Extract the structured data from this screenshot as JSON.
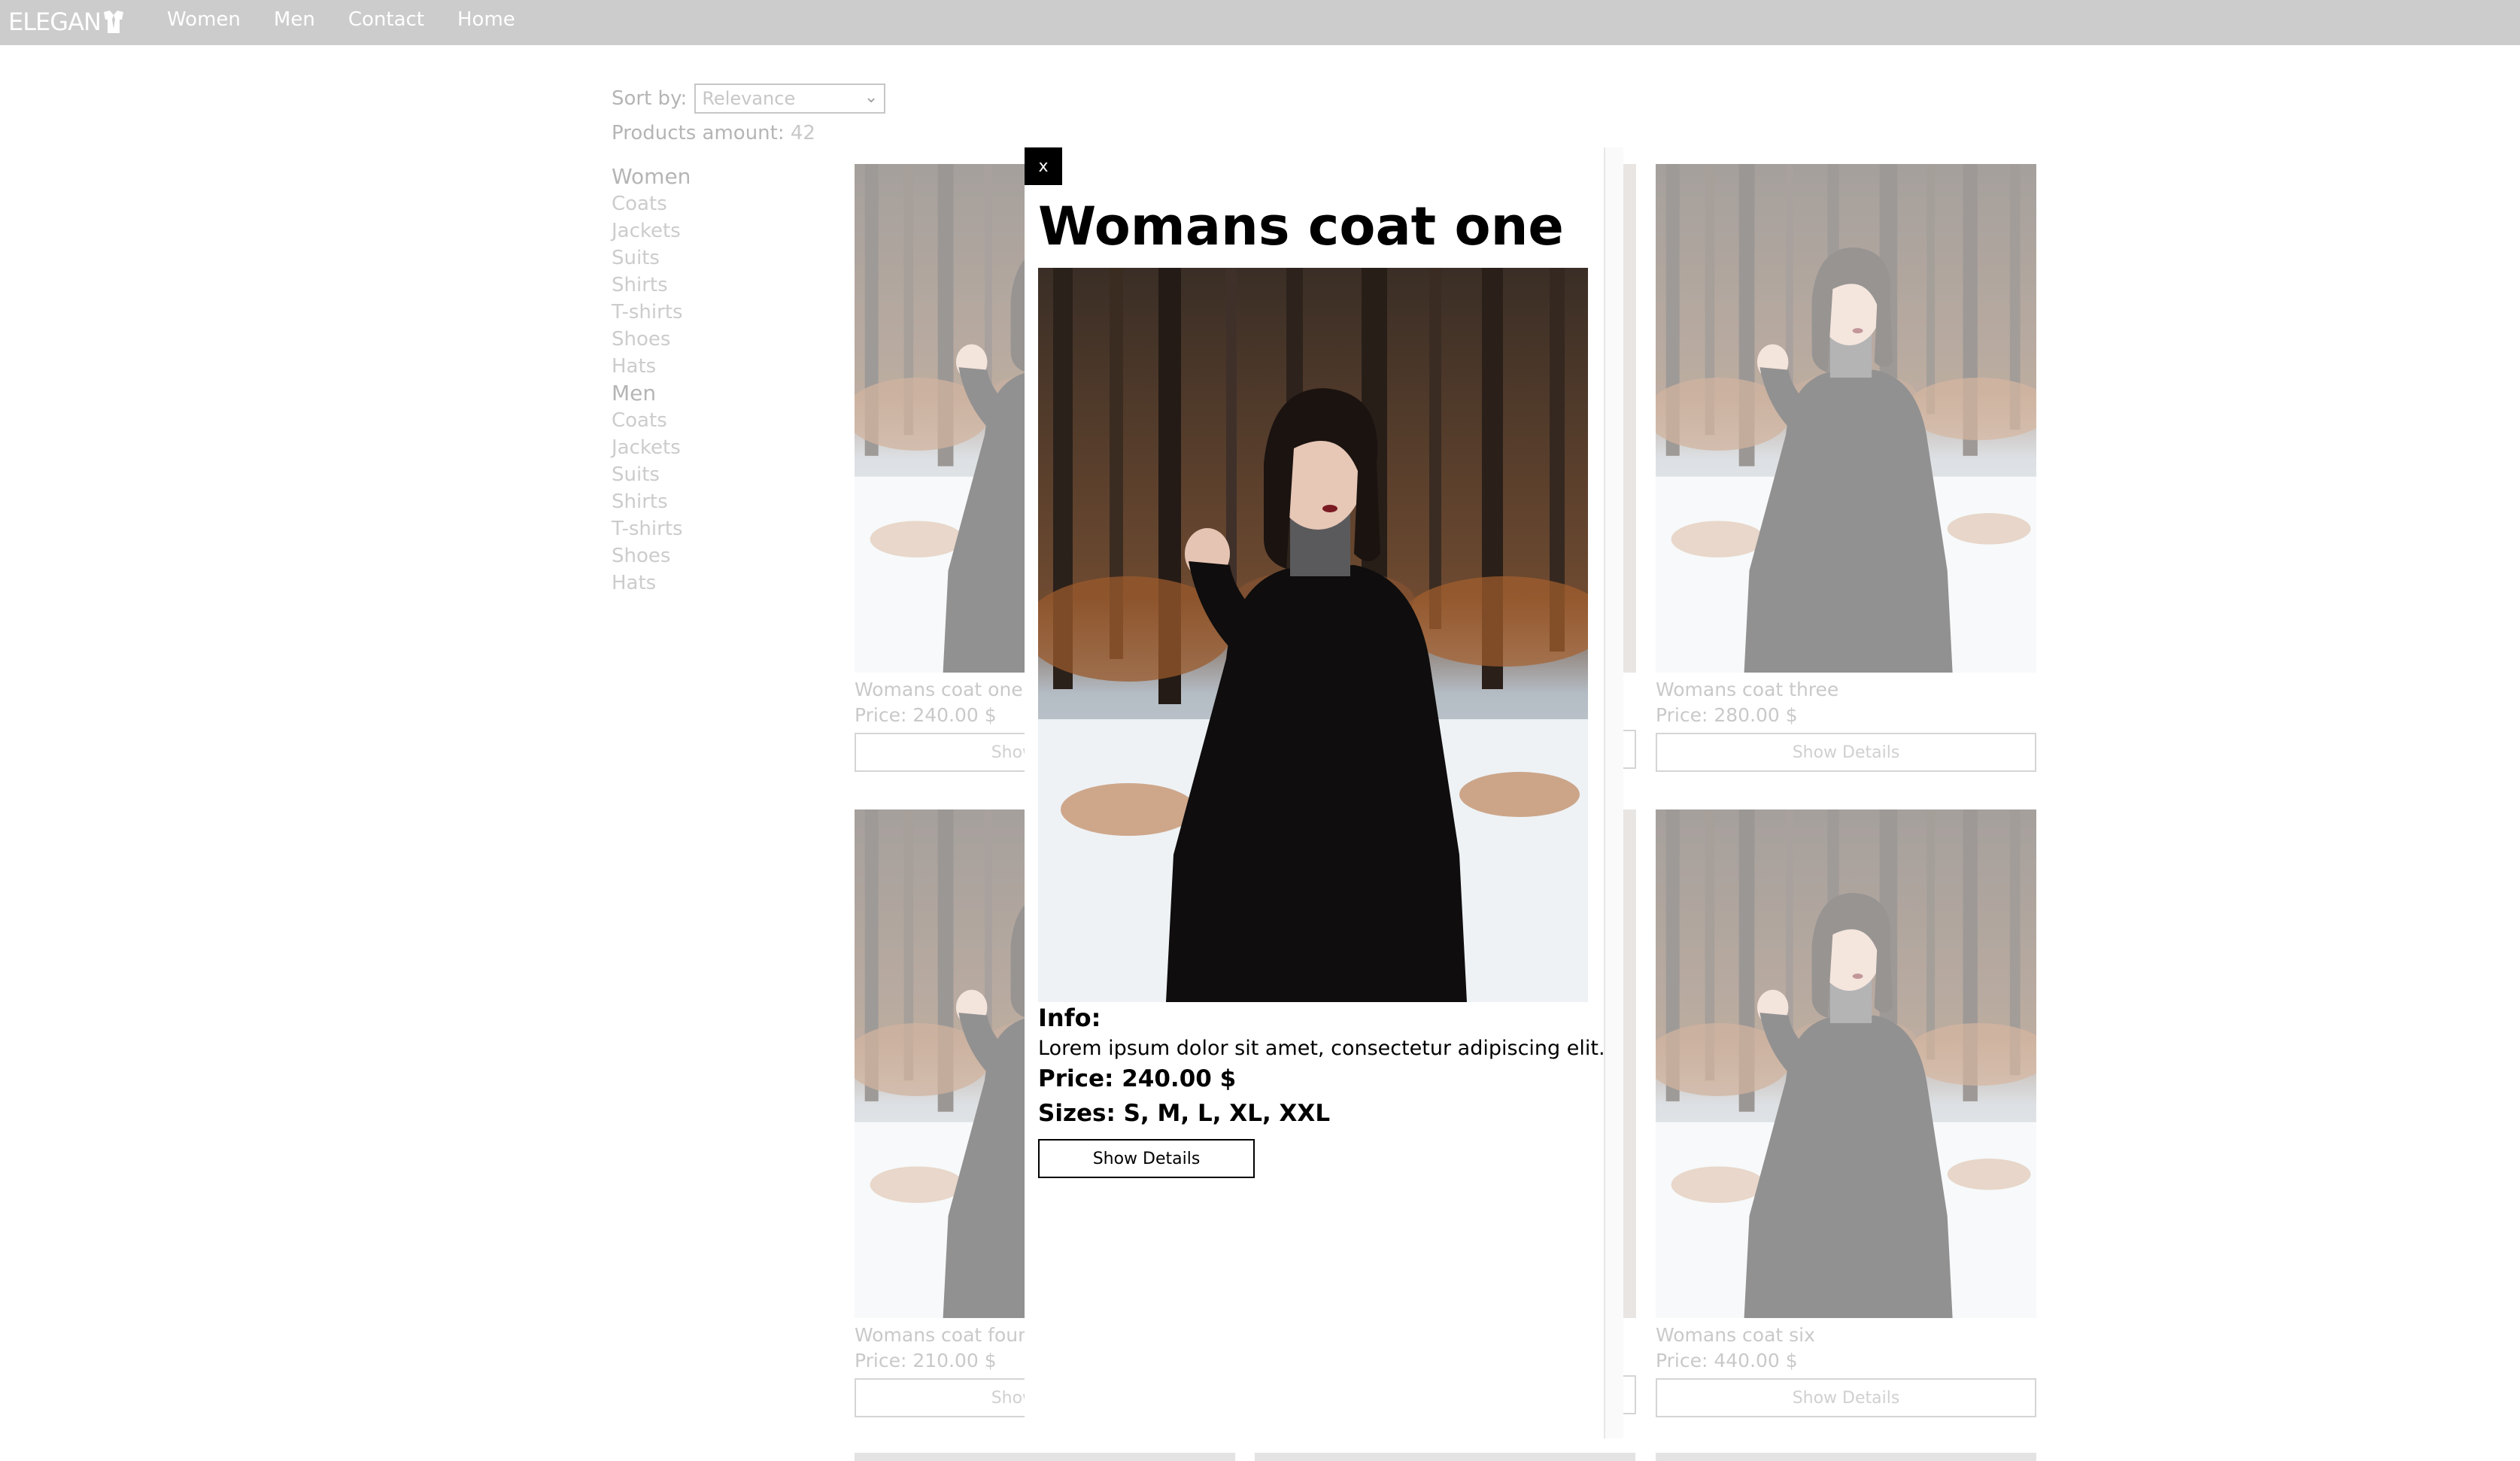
{
  "header": {
    "logo_text": "ELEGAN",
    "nav": [
      "Women",
      "Men",
      "Contact",
      "Home"
    ]
  },
  "sort": {
    "label": "Sort by:",
    "selected": "Relevance"
  },
  "products_amount": {
    "label": "Products amount:",
    "value": "42"
  },
  "categories": [
    {
      "title": "Women",
      "items": [
        "Coats",
        "Jackets",
        "Suits",
        "Shirts",
        "T-shirts",
        "Shoes",
        "Hats"
      ]
    },
    {
      "title": "Men",
      "items": [
        "Coats",
        "Jackets",
        "Suits",
        "Shirts",
        "T-shirts",
        "Shoes",
        "Hats"
      ]
    }
  ],
  "products": [
    {
      "name": "Womans coat one",
      "price": "Price: 240.00 $",
      "button": "Show Details"
    },
    {
      "name": "Womans coat three",
      "price": "Price: 280.00 $",
      "button": "Show Details"
    },
    {
      "name": "Womans coat four",
      "price": "Price: 210.00 $",
      "button": "Show Details"
    },
    {
      "name": "Womans coat six",
      "price": "Price: 440.00 $",
      "button": "Show Details"
    }
  ],
  "modal": {
    "close_label": "x",
    "title": "Womans coat one",
    "info_label": "Info:",
    "info_text": "Lorem ipsum dolor sit amet, consectetur adipiscing elit.",
    "price": "Price: 240.00 $",
    "sizes": "Sizes: S, M, L, XL, XXL",
    "button": "Show Details"
  },
  "colors": {
    "topbar": "#cccccc",
    "modal_close_bg": "#000000",
    "text_dark": "#000000"
  }
}
